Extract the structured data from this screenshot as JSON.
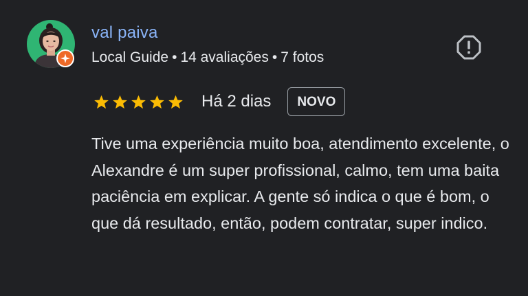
{
  "review": {
    "author": {
      "name": "val paiva",
      "badge_label": "Local Guide",
      "reviews_count": "14 avaliações",
      "photos_count": "7 fotos",
      "separator": "•"
    },
    "rating": 5,
    "date": "Há 2 dias",
    "new_badge": "NOVO",
    "text": "Tive uma experiência muito boa, atendimento excelente, o Alexandre é um super profissional, calmo, tem uma baita paciência em explicar. A gente só indica o que é bom, o que dá resultado, então, podem contratar, super indico."
  },
  "colors": {
    "background": "#202124",
    "author_name": "#8ab4f8",
    "star": "#fbbc04",
    "avatar_bg": "#2fb573",
    "guide_badge": "#ee6a28"
  },
  "icons": {
    "report": "report-octagon-icon",
    "guide_badge": "local-guide-star-icon",
    "rating_star": "star-icon"
  }
}
